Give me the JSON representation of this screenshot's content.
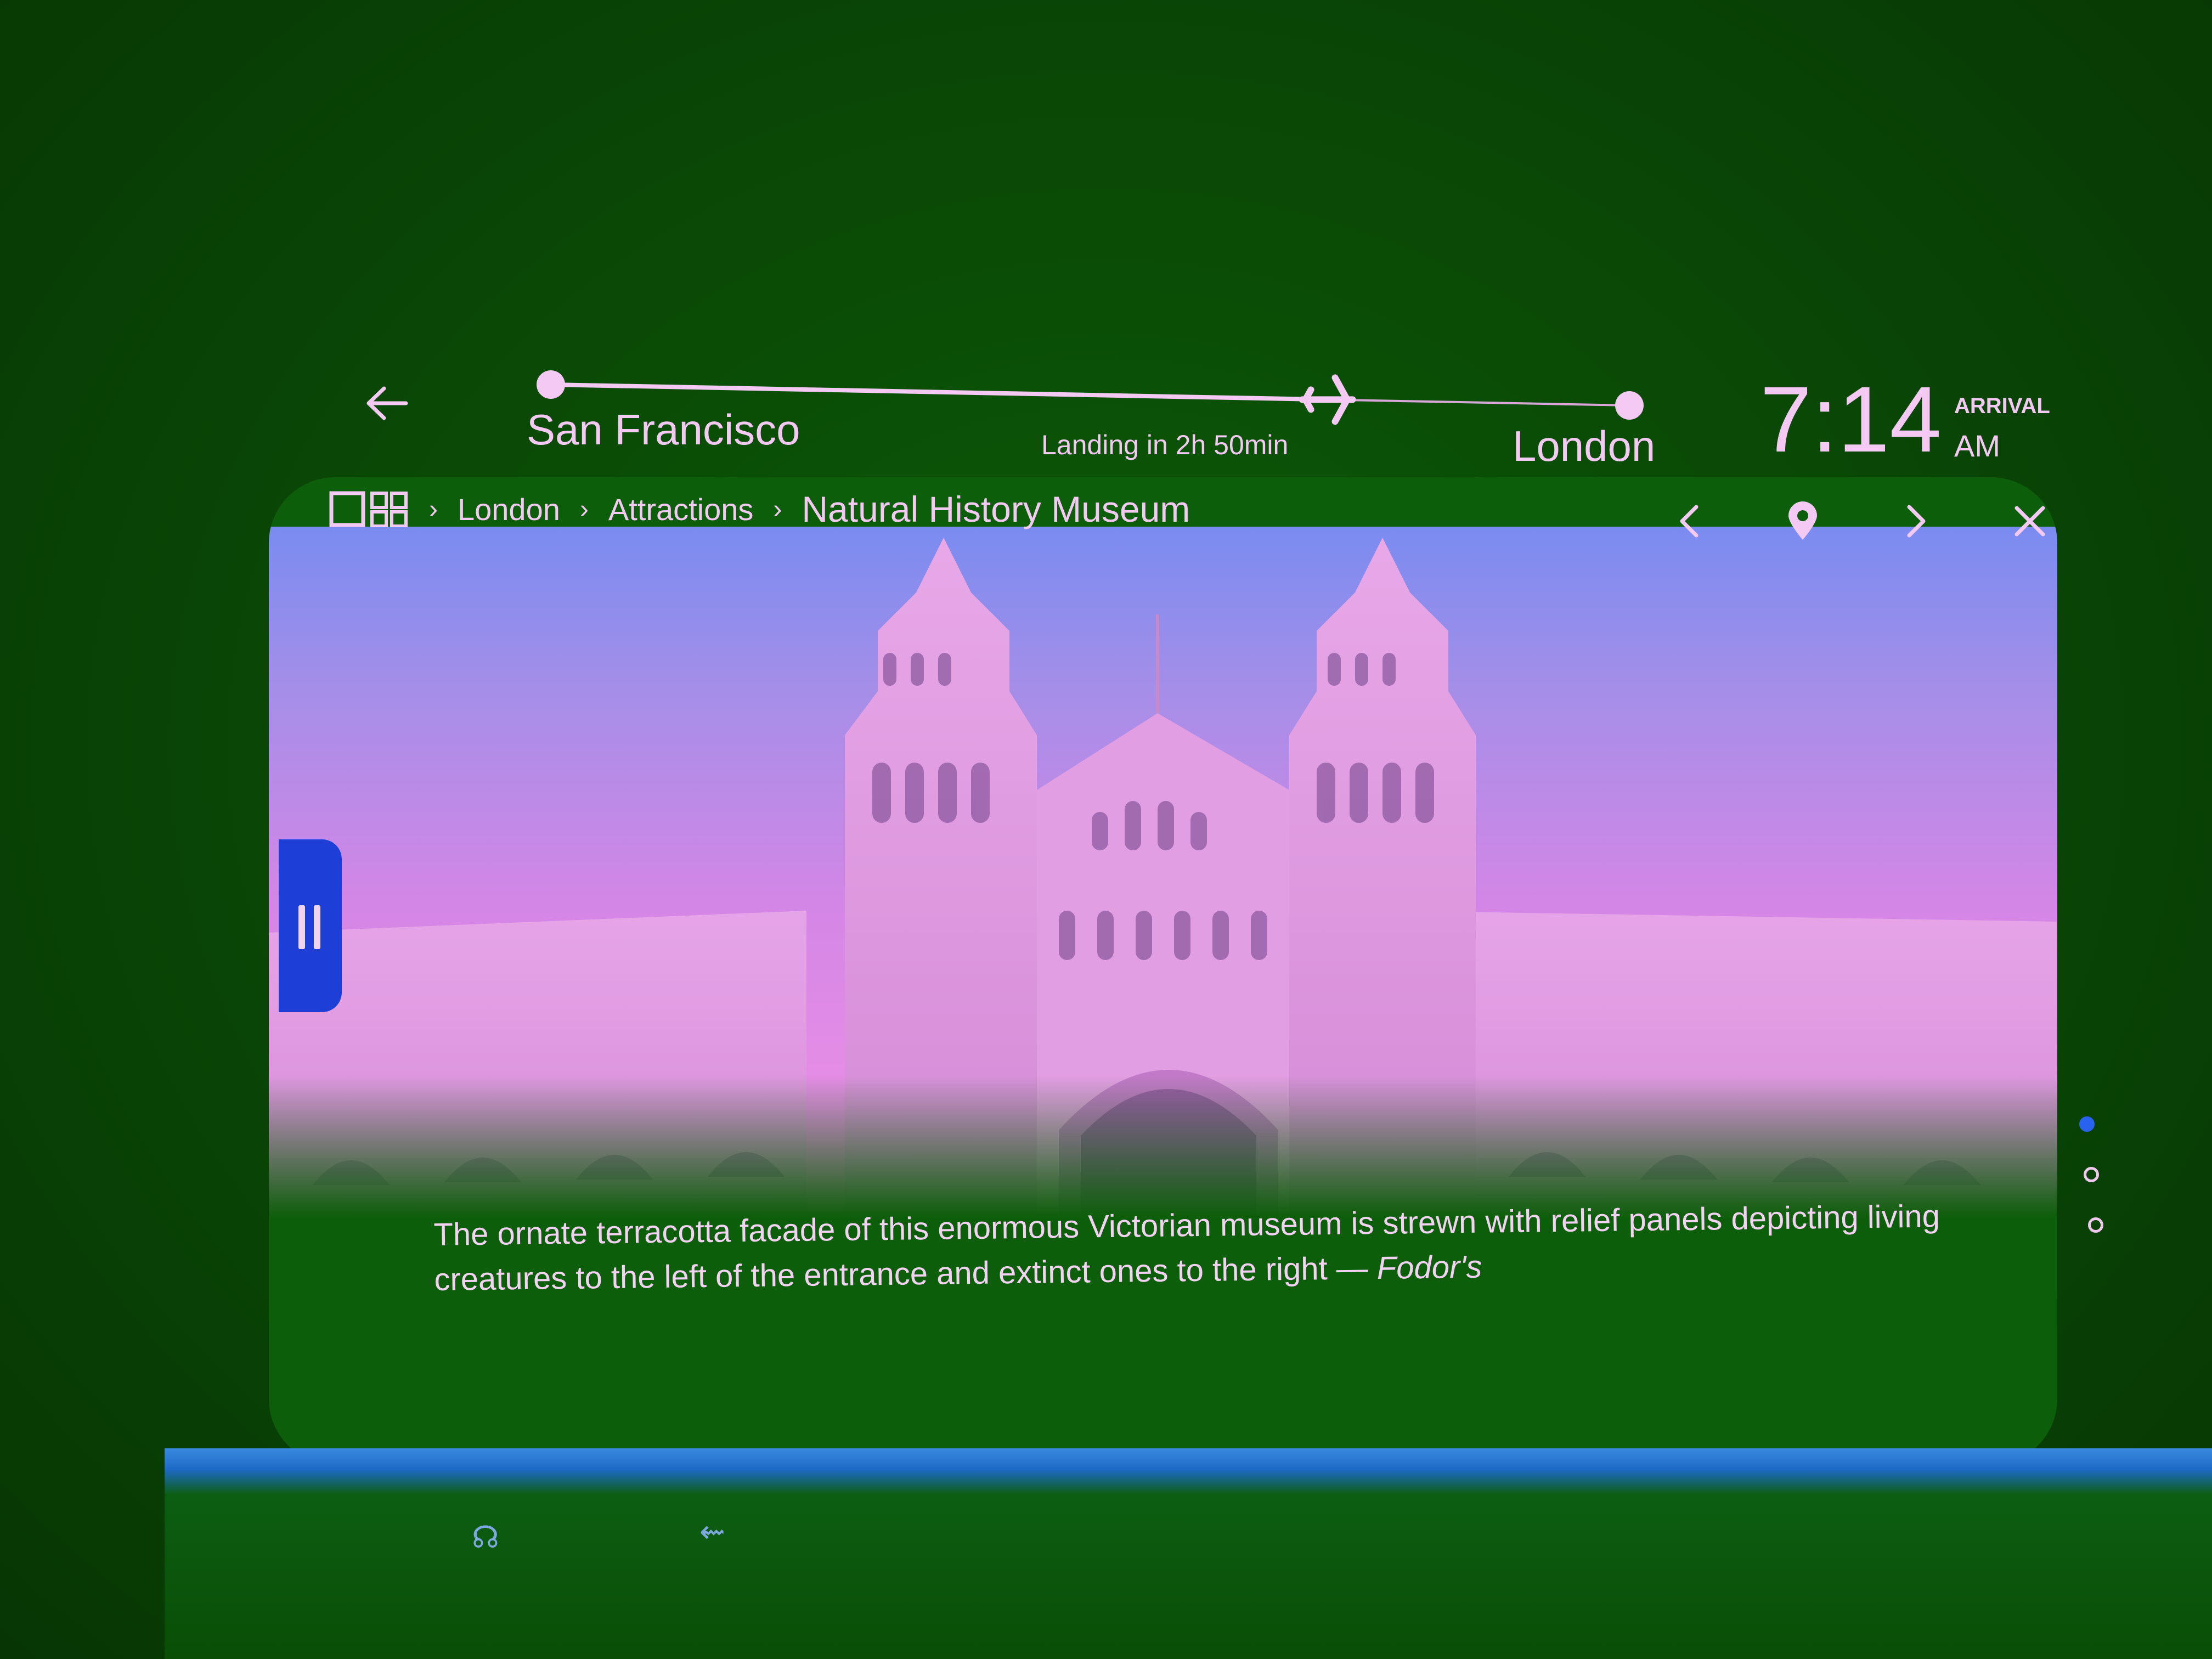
{
  "flight": {
    "origin": "San Francisco",
    "destination": "London",
    "landing_text": "Landing in 2h 50min",
    "progress": 0.72,
    "arrival_time": "7:14",
    "arrival_label": "ARRIVAL",
    "arrival_ampm": "AM"
  },
  "breadcrumb": {
    "items": [
      "London",
      "Attractions"
    ],
    "current": "Natural History Museum"
  },
  "caption": {
    "text": "The ornate terracotta facade of this enormous Victorian museum is strewn with relief panels depicting living creatures to the left of the entrance and extinct ones to the right — ",
    "source": "Fodor's"
  },
  "pager": {
    "count": 3,
    "active": 0
  },
  "icons": {
    "back": "arrow-left-icon",
    "home": "grid-home-icon",
    "prev": "chevron-left-icon",
    "map": "map-pin-icon",
    "next": "chevron-right-icon",
    "close": "close-icon",
    "pause": "pause-icon",
    "plane": "airplane-icon",
    "headphones": "headphone-jack-icon",
    "usb": "usb-icon"
  },
  "colors": {
    "text": "#f4c9f4",
    "accent": "#1d3fd8",
    "active_dot": "#2a62f0"
  }
}
